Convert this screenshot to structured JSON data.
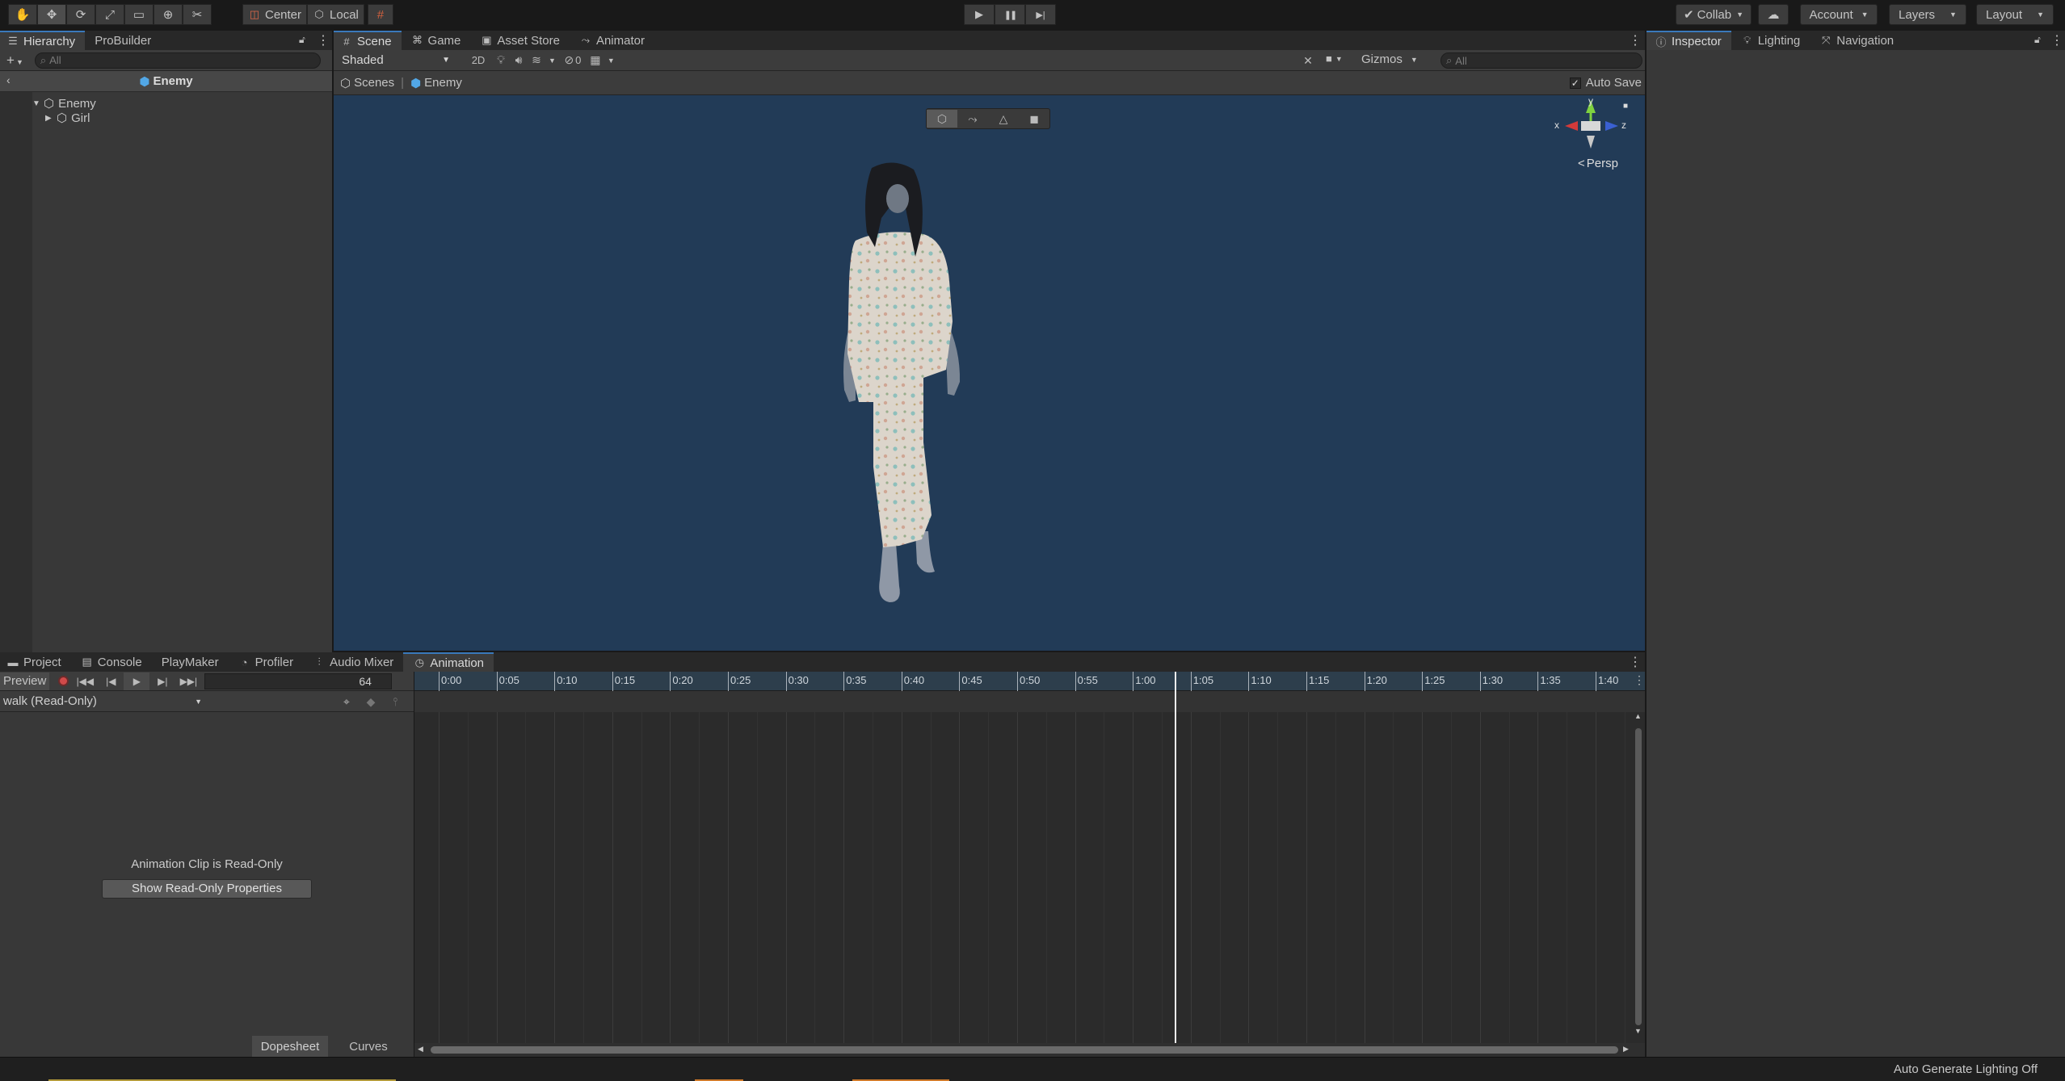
{
  "toolbar": {
    "tools": [
      {
        "name": "hand-tool-icon",
        "glyph": "✋"
      },
      {
        "name": "move-tool-icon",
        "glyph": "✥"
      },
      {
        "name": "rotate-tool-icon",
        "glyph": "⟳"
      },
      {
        "name": "scale-tool-icon",
        "glyph": "⤢"
      },
      {
        "name": "rect-tool-icon",
        "glyph": "▭"
      },
      {
        "name": "transform-tool-icon",
        "glyph": "⊕"
      },
      {
        "name": "custom-tool-icon",
        "glyph": "✂"
      }
    ],
    "pivot_label": "Center",
    "space_label": "Local",
    "play_glyph": "▶",
    "pause_glyph": "❚❚",
    "step_glyph": "▶|",
    "collab_label": "Collab",
    "account_label": "Account",
    "layers_label": "Layers",
    "layout_label": "Layout"
  },
  "hierarchy": {
    "tab_label": "Hierarchy",
    "probuilder_label": "ProBuilder",
    "search_placeholder": "All",
    "breadcrumb": "Enemy",
    "items": [
      {
        "label": "Enemy",
        "expanded": true,
        "depth": 0
      },
      {
        "label": "Girl",
        "expanded": false,
        "depth": 1
      }
    ]
  },
  "scene": {
    "tabs": [
      "Scene",
      "Game",
      "Asset Store",
      "Animator"
    ],
    "shading": "Shaded",
    "mode_2d": "2D",
    "hidden_count": "0",
    "gizmos_label": "Gizmos",
    "search_placeholder": "All",
    "breadcrumb_scenes": "Scenes",
    "breadcrumb_prefab": "Enemy",
    "auto_save_label": "Auto Save",
    "auto_save_checked": true,
    "persp_label": "Persp",
    "axis_labels": {
      "x": "x",
      "y": "y",
      "z": "z"
    },
    "background_color": "#223b57"
  },
  "inspector": {
    "tabs": [
      "Inspector",
      "Lighting",
      "Navigation"
    ]
  },
  "bottom": {
    "tabs": [
      "Project",
      "Console",
      "PlayMaker",
      "Profiler",
      "Audio Mixer",
      "Animation"
    ],
    "preview_label": "Preview",
    "frame_value": "64",
    "clip_name": "walk (Read-Only)",
    "read_only_message": "Animation Clip is Read-Only",
    "show_props_button": "Show Read-Only Properties",
    "dopesheet_label": "Dopesheet",
    "curves_label": "Curves",
    "timeline_ticks": [
      "0:00",
      "0:05",
      "0:10",
      "0:15",
      "0:20",
      "0:25",
      "0:30",
      "0:35",
      "0:40",
      "0:45",
      "0:50",
      "0:55",
      "1:00",
      "1:05",
      "1:10",
      "1:15",
      "1:20",
      "1:25",
      "1:30",
      "1:35",
      "1:40"
    ],
    "playhead_time": "1:04"
  },
  "status": {
    "text": "Auto Generate Lighting Off"
  },
  "colors": {
    "accent": "#3a79bb",
    "record": "#d04a4a",
    "scene_bg": "#223b57"
  }
}
